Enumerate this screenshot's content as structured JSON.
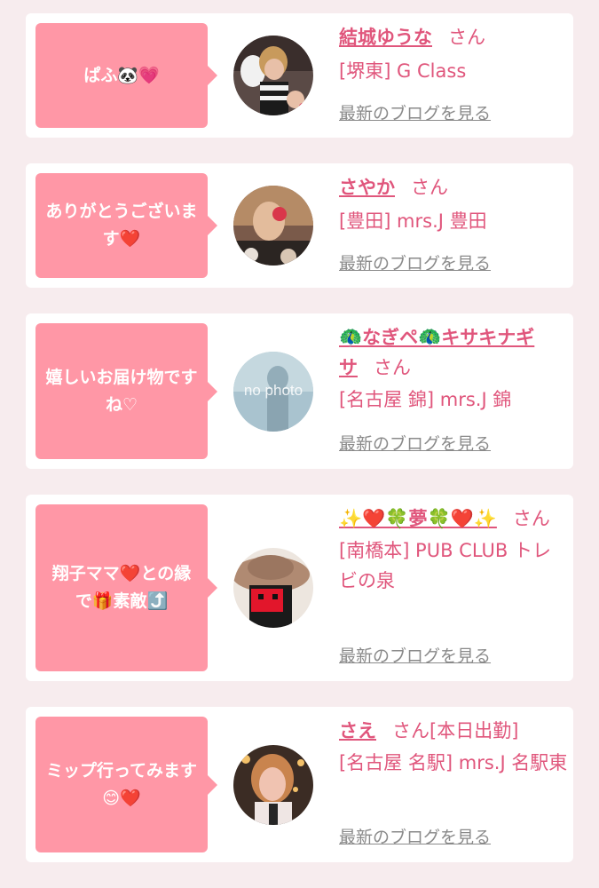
{
  "entries": [
    {
      "message": "ぱふ🐼💗",
      "name": "結城ゆうな",
      "suffix": "さん",
      "shop": "[堺東] G Class",
      "blog_link": "最新のブログを見る",
      "avatar_icon": "avatar-photo-icon"
    },
    {
      "message": "ありがとうございます❤️",
      "name": "さやか",
      "suffix": "さん",
      "shop": "[豊田] mrs.J 豊田",
      "blog_link": "最新のブログを見る",
      "avatar_icon": "avatar-photo-icon"
    },
    {
      "message": "嬉しいお届け物ですね♡",
      "name": "🦚なぎペ🦚キサキナギサ",
      "suffix": "さん",
      "shop": "[名古屋 錦] mrs.J 錦",
      "blog_link": "最新のブログを見る",
      "avatar_icon": "no-photo-icon",
      "avatar_text": "no photo"
    },
    {
      "message": "翔子ママ❤️との縁で🎁素敵⤴️",
      "name": "✨❤️🍀夢🍀❤️✨",
      "suffix": "さん",
      "shop": "[南橋本] PUB CLUB トレビの泉",
      "blog_link": "最新のブログを見る",
      "avatar_icon": "avatar-photo-icon"
    },
    {
      "message": "ミップ行ってみます😊❤️",
      "name": "さえ",
      "suffix": "さん[本日出勤]",
      "shop": "[名古屋 名駅] mrs.J 名駅東",
      "blog_link": "最新のブログを見る",
      "avatar_icon": "avatar-photo-icon"
    }
  ],
  "colors": {
    "page_background": "#f7ecee",
    "bubble": "#ff97a6",
    "accent_text": "#e0567c",
    "link_gray": "#8a8a8a"
  }
}
